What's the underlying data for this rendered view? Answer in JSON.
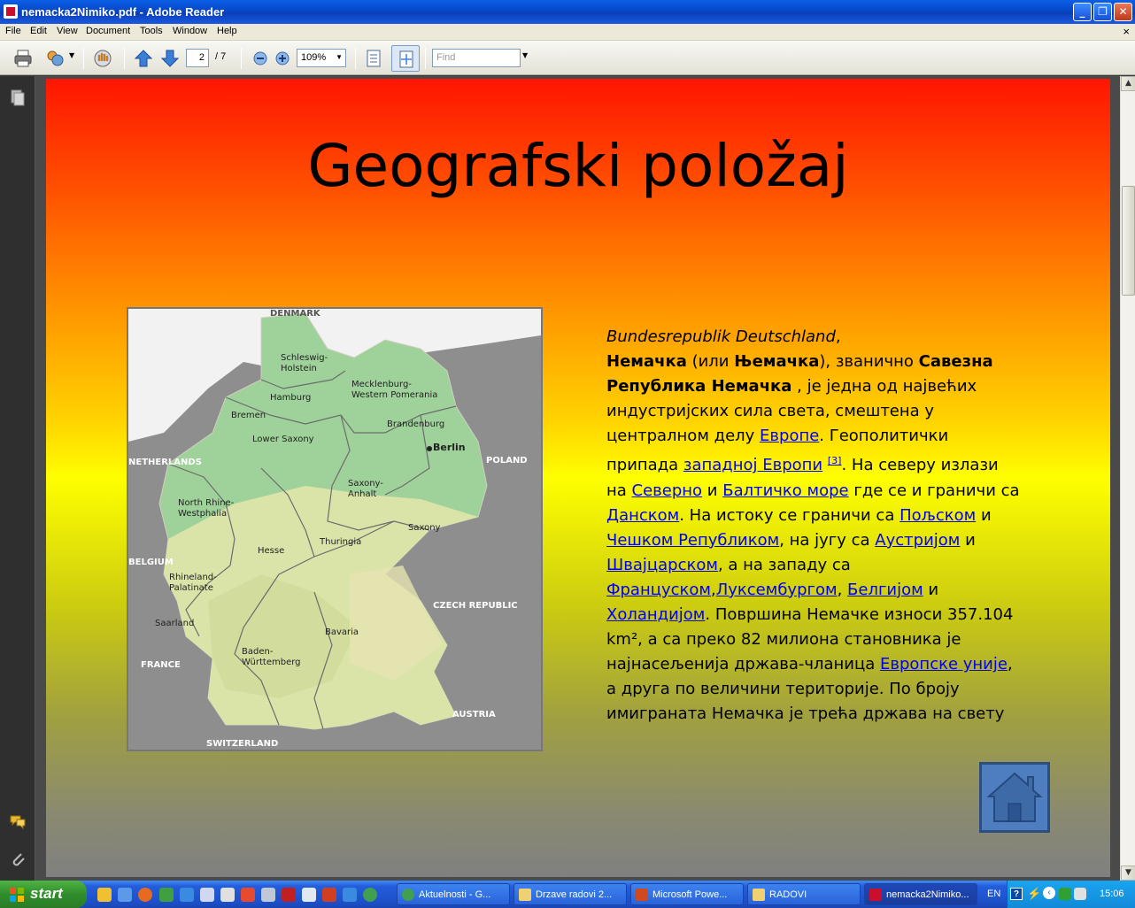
{
  "window": {
    "title": "nemacka2Nimiko.pdf - Adobe Reader"
  },
  "menu": [
    "File",
    "Edit",
    "View",
    "Document",
    "Tools",
    "Window",
    "Help"
  ],
  "toolbar": {
    "page_current": "2",
    "page_total": "/ 7",
    "zoom": "109%",
    "find_placeholder": "Find"
  },
  "slide": {
    "title": "Geografski položaj",
    "map_labels": {
      "denmark": "DENMARK",
      "schleswig": "Schleswig-\nHolstein",
      "mecklenburg": "Mecklenburg-\nWestern Pomerania",
      "hamburg": "Hamburg",
      "bremen": "Bremen",
      "brandenburg": "Brandenburg",
      "berlin": "Berlin",
      "lower_saxony": "Lower Saxony",
      "netherlands": "NETHERLANDS",
      "poland": "POLAND",
      "saxony_anhalt": "Saxony-\nAnhalt",
      "nrw": "North Rhine-\nWestphalia",
      "saxony": "Saxony",
      "thuringia": "Thuringia",
      "hesse": "Hesse",
      "belgium": "BELGIUM",
      "rhineland": "Rhineland-\nPalatinate",
      "czech": "CZECH REPUBLIC",
      "saarland": "Saarland",
      "bavaria": "Bavaria",
      "baden": "Baden-\nWürttemberg",
      "france": "FRANCE",
      "austria": "AUSTRIA",
      "switzerland": "SWITZERLAND"
    },
    "text": {
      "l1_italic": "Bundesrepublik Deutschland",
      "l1_comma": ",",
      "nemacka": "Немачка",
      "ili": " (или ",
      "njemacka": "Њемачка",
      "zvanicno": "), званично ",
      "savezna": "Савезна Република Немачка",
      "p1": " , је једна од највећих индустријских сила света, смештена у централном делу ",
      "evrope": "Европе",
      "p2": ". Геополитички припада ",
      "zapadnoj": "западној Европи",
      "ref": "[3]",
      "p3": ". На северу излази на ",
      "severno": "Северно",
      "i1": " и ",
      "balticko": "Балтичко море",
      "p4": " где се и граничи са ",
      "danskom": "Данском",
      "p5": ". На истоку се граничи са ",
      "poljskom": "Пољском",
      "i2": " и ",
      "ceskom": "Чешком Републиком",
      "p6": ", на југу са ",
      "austrijom": "Аустријом",
      "i3": " и ",
      "svajcarskom": "Швајцарском",
      "p7": ", а на западу са ",
      "francuskom": "Француском",
      "comma1": ",",
      "luksemburgom": "Луксембургом",
      "comma2": ", ",
      "belgijom": "Белгијом",
      "i4": " и ",
      "holandijom": "Холандијом",
      "p8": ". Површина Немачке износи 357.104 km², а са преко 82 милиона становника је најнасељенија држава-чланица ",
      "eu": "Европске уније",
      "p9": ", а друга по величини територије. По броју имиграната Немачка је трећа држава на свету"
    }
  },
  "taskbar": {
    "start": "start",
    "tasks": [
      "Aktuelnosti - G...",
      "Drzave radovi 2...",
      "Microsoft Powe...",
      "RADOVI",
      "nemacka2Nimiko..."
    ],
    "lang": "EN",
    "clock": "15:06"
  },
  "colors": {
    "slide_top": "#ff1500",
    "slide_mid": "#ffff00",
    "slide_bottom": "#808080",
    "link": "#0000ee",
    "home_button": "#4f7ec0"
  }
}
